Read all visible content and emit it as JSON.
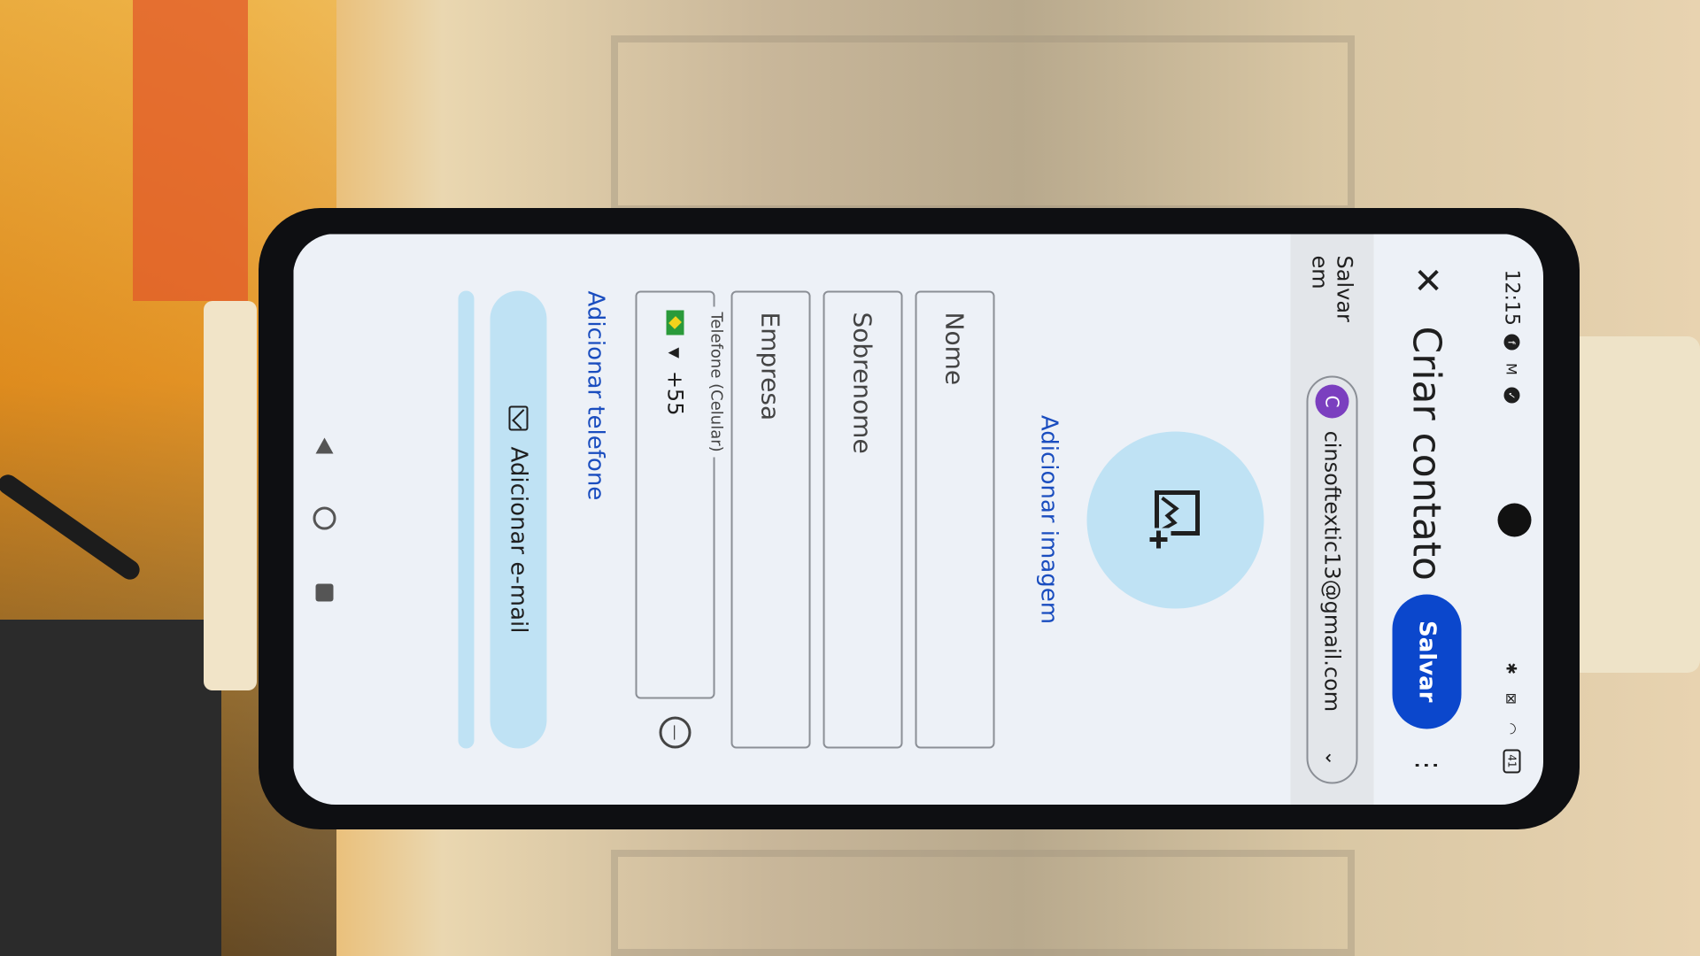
{
  "status_bar": {
    "time": "12:15",
    "battery": "41"
  },
  "app_bar": {
    "title": "Criar contato",
    "save_label": "Salvar"
  },
  "save_in": {
    "label": "Salvar em",
    "avatar_letter": "C",
    "account_email": "cinsoftextic13@gmail.com"
  },
  "photo": {
    "add_image_label": "Adicionar imagem"
  },
  "form": {
    "first_name_placeholder": "Nome",
    "last_name_placeholder": "Sobrenome",
    "company_placeholder": "Empresa",
    "phone_label": "Telefone (Celular)",
    "country_code": "+55",
    "add_phone_label": "Adicionar telefone",
    "add_email_label": "Adicionar e-mail"
  },
  "icons": {
    "close": "close-icon",
    "more": "more-vert-icon",
    "add_photo": "add-photo-icon",
    "mail": "mail-icon",
    "clear": "remove-icon"
  },
  "colors": {
    "primary": "#0b47cc",
    "accent_light": "#bfe2f4",
    "avatar": "#7b3fbf",
    "link": "#1a4dbf"
  }
}
